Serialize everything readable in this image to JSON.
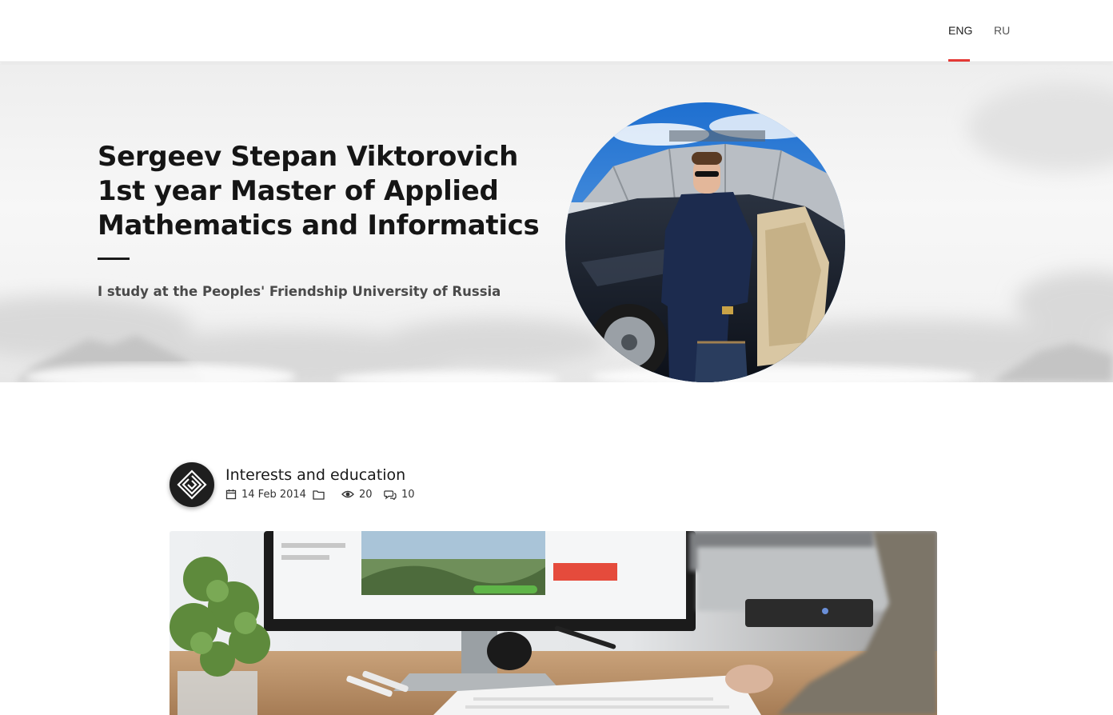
{
  "nav": {
    "languages": [
      {
        "label": "ENG",
        "active": true
      },
      {
        "label": "RU",
        "active": false
      }
    ],
    "accent_color": "#e53935"
  },
  "hero": {
    "title": "Sergeev Stepan Viktorovich 1st year Master of Applied Mathematics and Informatics",
    "subtitle": "I study at the Peoples' Friendship University of Russia",
    "portrait": "profile-photo-man-beside-car"
  },
  "post": {
    "avatar_icon": "layered-diamond-logo-icon",
    "title": "Interests and education",
    "date": "14 Feb 2014",
    "category": "",
    "views": "20",
    "comments": "10",
    "image": "desk-with-monitor-keyboard-plant-photo"
  }
}
